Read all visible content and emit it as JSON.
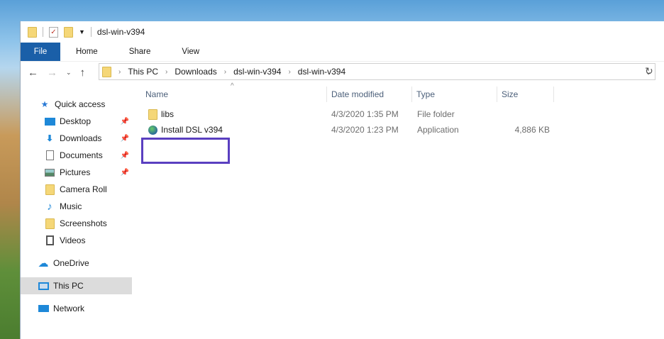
{
  "window": {
    "title": "dsl-win-v394"
  },
  "ribbon": {
    "tabs": [
      "File",
      "Home",
      "Share",
      "View"
    ]
  },
  "address": {
    "crumbs": [
      "This PC",
      "Downloads",
      "dsl-win-v394",
      "dsl-win-v394"
    ]
  },
  "sidebar": {
    "items": [
      {
        "label": "Quick access",
        "icon": "star-icon"
      },
      {
        "label": "Desktop",
        "icon": "desktop-icon",
        "pinned": true
      },
      {
        "label": "Downloads",
        "icon": "download-icon",
        "pinned": true
      },
      {
        "label": "Documents",
        "icon": "document-icon",
        "pinned": true
      },
      {
        "label": "Pictures",
        "icon": "pictures-icon",
        "pinned": true
      },
      {
        "label": "Camera Roll",
        "icon": "folder-icon"
      },
      {
        "label": "Music",
        "icon": "music-icon"
      },
      {
        "label": "Screenshots",
        "icon": "folder-icon"
      },
      {
        "label": "Videos",
        "icon": "video-icon"
      },
      {
        "label": "OneDrive",
        "icon": "cloud-icon"
      },
      {
        "label": "This PC",
        "icon": "pc-icon",
        "selected": true
      },
      {
        "label": "Network",
        "icon": "network-icon"
      }
    ]
  },
  "columns": {
    "name": "Name",
    "date": "Date modified",
    "type": "Type",
    "size": "Size"
  },
  "files": [
    {
      "name": "libs",
      "date": "4/3/2020 1:35 PM",
      "type": "File folder",
      "size": ""
    },
    {
      "name": "Install DSL v394",
      "date": "4/3/2020 1:23 PM",
      "type": "Application",
      "size": "4,886 KB"
    }
  ],
  "colors": {
    "file_tab": "#1a5fa8",
    "highlight": "#5a3fc0"
  }
}
